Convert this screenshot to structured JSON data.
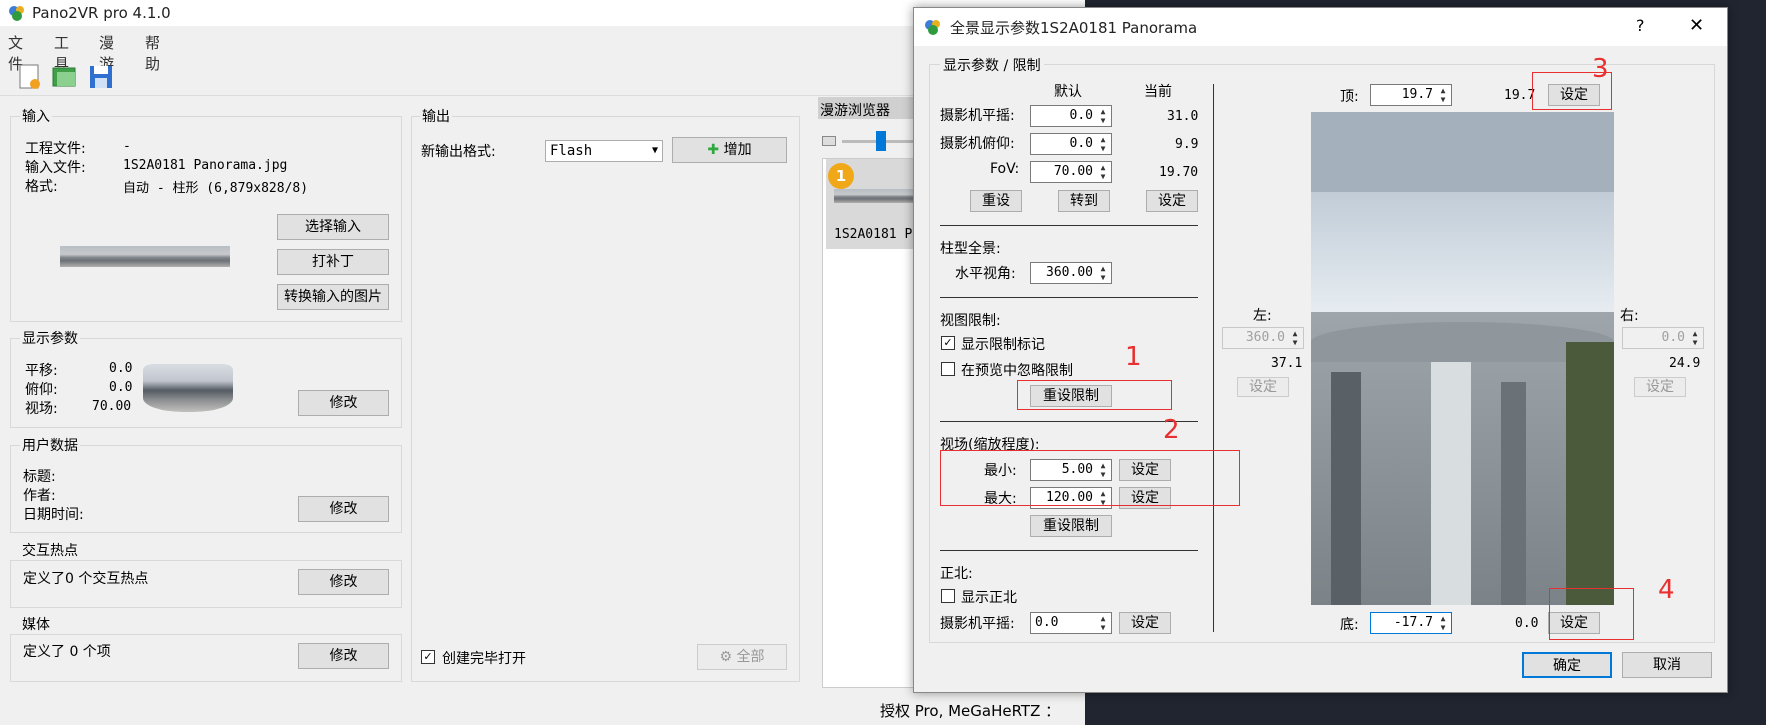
{
  "app": {
    "title": "Pano2VR pro 4.1.0",
    "menu": [
      "文件",
      "工具",
      "漫游",
      "帮助"
    ]
  },
  "input": {
    "title": "输入",
    "project_file_label": "工程文件:",
    "project_file_value": "-",
    "input_file_label": "输入文件:",
    "input_file_value": "1S2A0181 Panorama.jpg",
    "format_label": "格式:",
    "format_value": "自动 - 柱形 (6,879x828/8)",
    "select_input_btn": "选择输入",
    "patch_btn": "打补丁",
    "convert_btn": "转换输入的图片"
  },
  "display": {
    "title": "显示参数",
    "pan_label": "平移:",
    "pan_value": "0.0",
    "tilt_label": "俯仰:",
    "tilt_value": "0.0",
    "fov_label": "视场:",
    "fov_value": "70.00",
    "modify_btn": "修改"
  },
  "userdata": {
    "title": "用户数据",
    "title_label": "标题:",
    "author_label": "作者:",
    "datetime_label": "日期时间:",
    "modify_btn": "修改"
  },
  "hotspots": {
    "title": "交互热点",
    "text": "定义了0 个交互热点",
    "modify_btn": "修改"
  },
  "media": {
    "title": "媒体",
    "text": "定义了 0 个项",
    "modify_btn": "修改"
  },
  "output": {
    "title": "输出",
    "new_format_label": "新输出格式:",
    "format_selected": "Flash",
    "add_btn": "增加",
    "open_after_label": "创建完毕打开",
    "all_btn": "全部"
  },
  "tour": {
    "title": "漫游浏览器",
    "badge": "1",
    "item_label": "1S2A0181 P..."
  },
  "status": {
    "text": "授权 Pro, MeGaHeRTZ ："
  },
  "dialog": {
    "title": "全景显示参数1S2A0181 Panorama",
    "help": "?",
    "close": "✕",
    "breadcrumb": "显示参数 / 限制",
    "col_default": "默认",
    "col_current": "当前",
    "cam_pan_label": "摄影机平摇:",
    "cam_pan_default": "0.0",
    "cam_pan_current": "31.0",
    "cam_tilt_label": "摄影机俯仰:",
    "cam_tilt_default": "0.0",
    "cam_tilt_current": "9.9",
    "fov_label": "FoV:",
    "fov_default": "70.00",
    "fov_current": "19.70",
    "reset_btn": "重设",
    "goto_btn": "转到",
    "set_btn": "设定",
    "cyl_title": "柱型全景:",
    "hfov_label": "水平视角:",
    "hfov_value": "360.00",
    "view_limit_title": "视图限制:",
    "show_limit_marks": "显示限制标记",
    "ignore_in_preview": "在预览中忽略限制",
    "reset_limit_btn": "重设限制",
    "fov_zoom_title": "视场(缩放程度):",
    "min_label": "最小:",
    "min_value": "5.00",
    "max_label": "最大:",
    "max_value": "120.00",
    "reset_limit_btn2": "重设限制",
    "north_title": "正北:",
    "show_north": "显示正北",
    "north_pan_label": "摄影机平摇:",
    "north_pan_value": "0.0",
    "top_label": "顶:",
    "top_value": "19.7",
    "top_current": "19.7",
    "left_label": "左:",
    "left_value": "360.0",
    "left_current": "37.1",
    "right_label": "右:",
    "right_value": "0.0",
    "right_current": "24.9",
    "bottom_label": "底:",
    "bottom_value": "-17.7",
    "bottom_current": "0.0",
    "ok_btn": "确定",
    "cancel_btn": "取消",
    "annotations": [
      "1",
      "2",
      "3",
      "4"
    ]
  }
}
